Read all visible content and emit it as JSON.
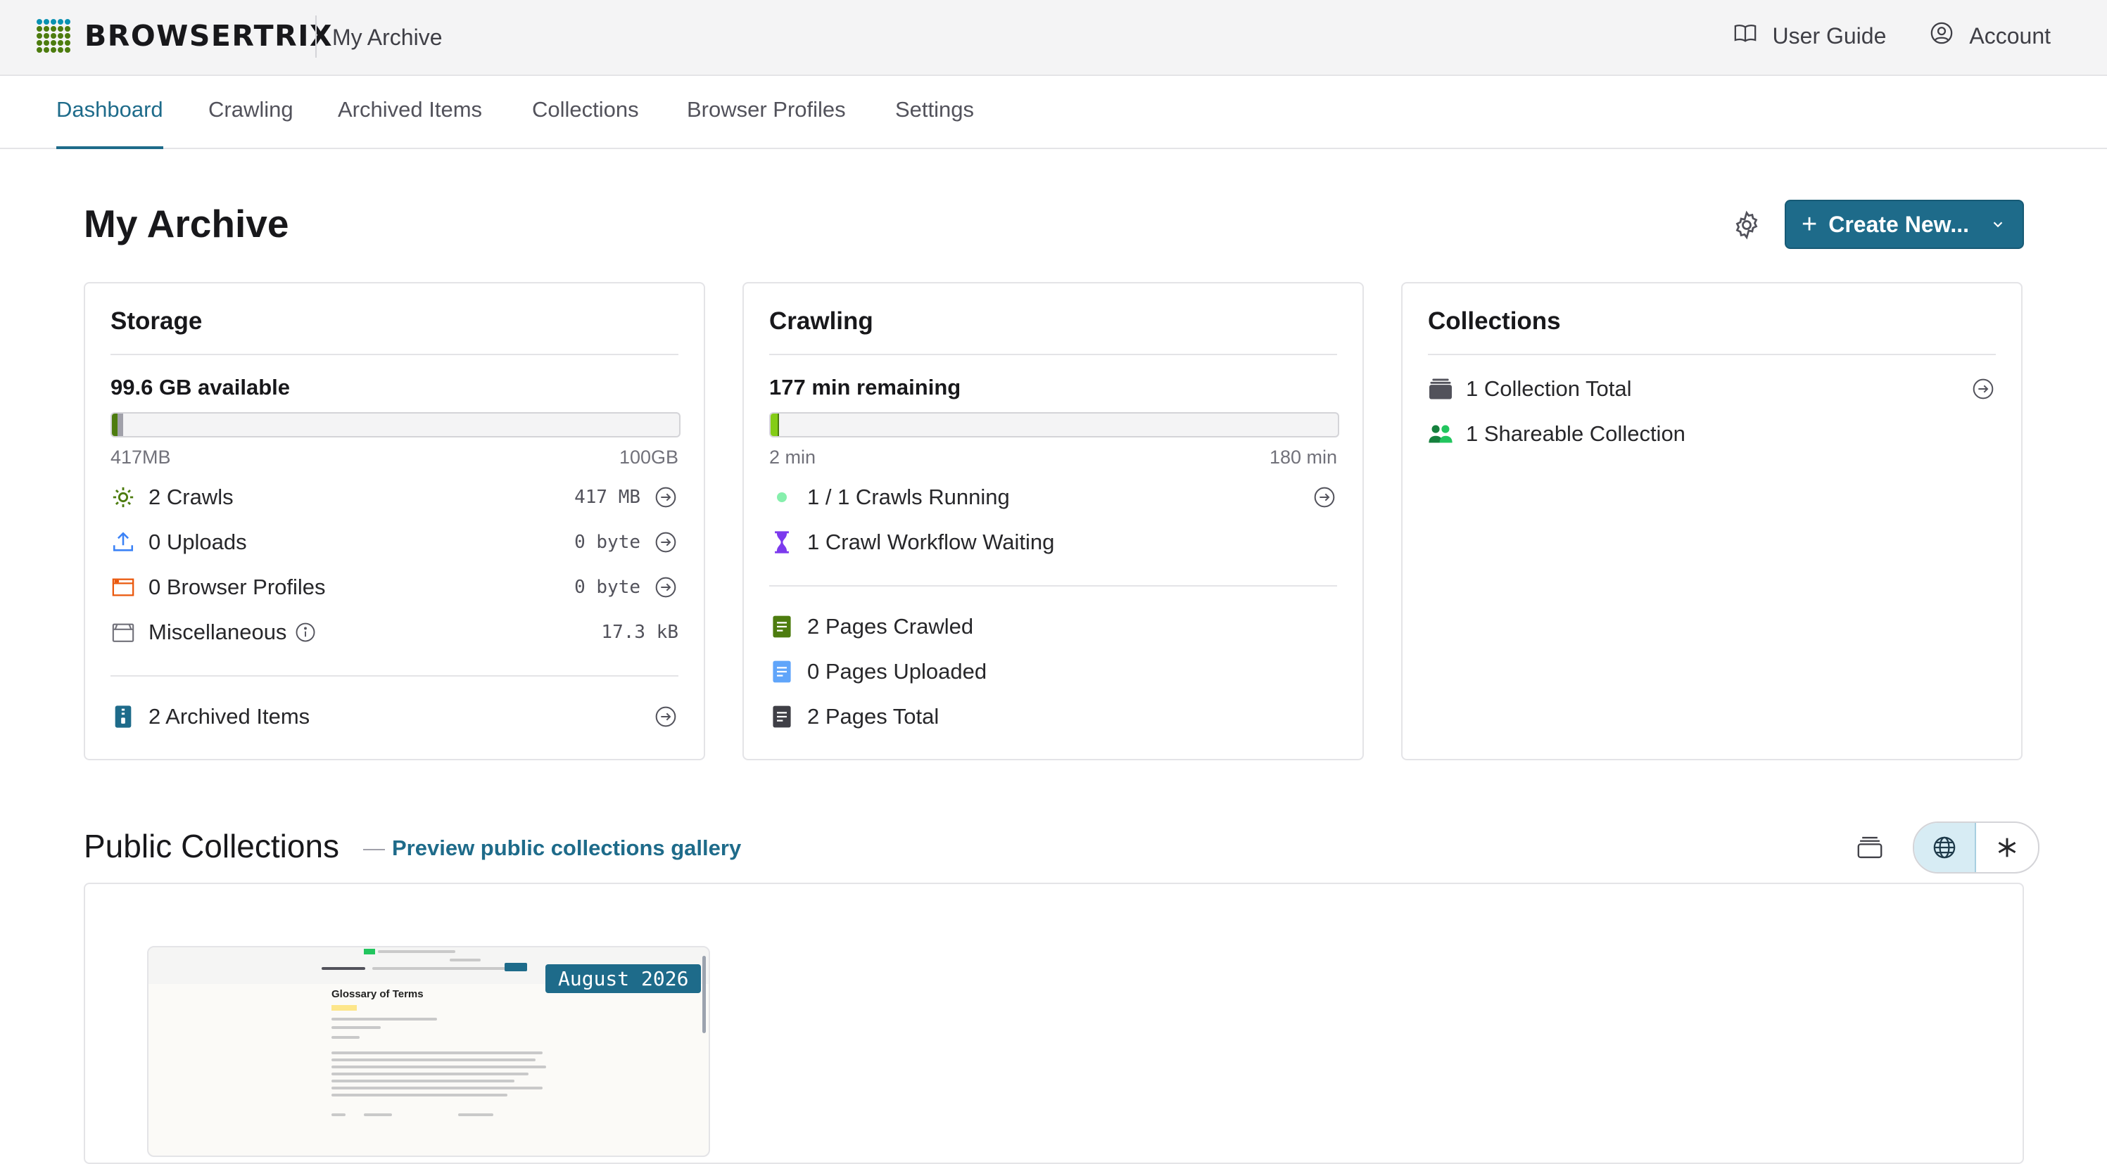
{
  "app": {
    "name": "BROWSERTRIX",
    "archive_name": "My Archive"
  },
  "topnav": {
    "user_guide": "User Guide",
    "account": "Account"
  },
  "tabs": [
    "Dashboard",
    "Crawling",
    "Archived Items",
    "Collections",
    "Browser Profiles",
    "Settings"
  ],
  "active_tab": "Dashboard",
  "page": {
    "title": "My Archive",
    "create_label": "Create New..."
  },
  "storage": {
    "title": "Storage",
    "available": "99.6 GB available",
    "used_fraction": 0.0042,
    "min_label": "417MB",
    "max_label": "100GB",
    "rows": [
      {
        "label": "2 Crawls",
        "value": "417 MB",
        "icon": "gear-icon"
      },
      {
        "label": "0 Uploads",
        "value": "0 byte",
        "icon": "upload-icon"
      },
      {
        "label": "0 Browser Profiles",
        "value": "0 byte",
        "icon": "browser-window-icon"
      },
      {
        "label": "Miscellaneous",
        "value": "17.3 kB",
        "icon": "box-icon"
      }
    ],
    "archived_items": "2 Archived Items"
  },
  "crawling": {
    "title": "Crawling",
    "remaining": "177 min remaining",
    "used_fraction": 0.011,
    "min_label": "2 min",
    "max_label": "180 min",
    "running": "1 / 1 Crawls Running",
    "waiting": "1 Crawl Workflow Waiting",
    "pages_crawled": "2 Pages Crawled",
    "pages_uploaded": "0 Pages Uploaded",
    "pages_total": "2 Pages Total"
  },
  "collections": {
    "title": "Collections",
    "total": "1 Collection Total",
    "shareable": "1 Shareable Collection"
  },
  "public": {
    "title": "Public Collections",
    "link": "Preview public collections gallery",
    "dash": "—",
    "card": {
      "date": "August 2026",
      "thumb_title": "Glossary of Terms"
    }
  },
  "colors": {
    "accent": "#1e6b8a",
    "crawl_green": "#4d7c0f",
    "upload_blue": "#3b82f6",
    "profile_orange": "#ea580c"
  }
}
